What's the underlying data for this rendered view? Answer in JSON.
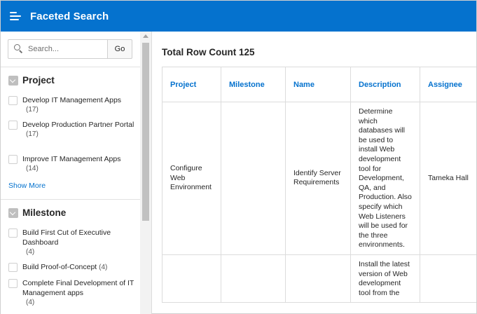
{
  "header": {
    "title": "Faceted Search"
  },
  "search": {
    "placeholder": "Search...",
    "go_label": "Go"
  },
  "facets": {
    "project": {
      "title": "Project",
      "options": [
        {
          "label": "Develop IT Management Apps",
          "count": "(17)"
        },
        {
          "label": "Develop Production Partner Portal",
          "count": "(17)"
        },
        {
          "label": "Improve IT Management Apps",
          "count": "(14)"
        }
      ],
      "show_more": "Show More"
    },
    "milestone": {
      "title": "Milestone",
      "options": [
        {
          "label": "Build First Cut of Executive Dashboard",
          "count": "(4)"
        },
        {
          "label": "Build Proof-of-Concept",
          "count": "(4)"
        },
        {
          "label": "Complete Final Development of IT Management apps",
          "count": "(4)"
        }
      ]
    }
  },
  "results": {
    "total_label": "Total Row Count 125",
    "columns": [
      "Project",
      "Milestone",
      "Name",
      "Description",
      "Assignee"
    ],
    "rows": [
      {
        "project": "Configure Web Environment",
        "milestone": "",
        "name": "Identify Server Requirements",
        "description": "Determine which databases will be used to install Web development tool for Development, QA, and Production. Also specify which Web Listeners will be used for the three environments.",
        "assignee": "Tameka Hall"
      },
      {
        "project": "",
        "milestone": "",
        "name": "",
        "description": "Install the latest version of Web development tool from the",
        "assignee": ""
      }
    ]
  }
}
